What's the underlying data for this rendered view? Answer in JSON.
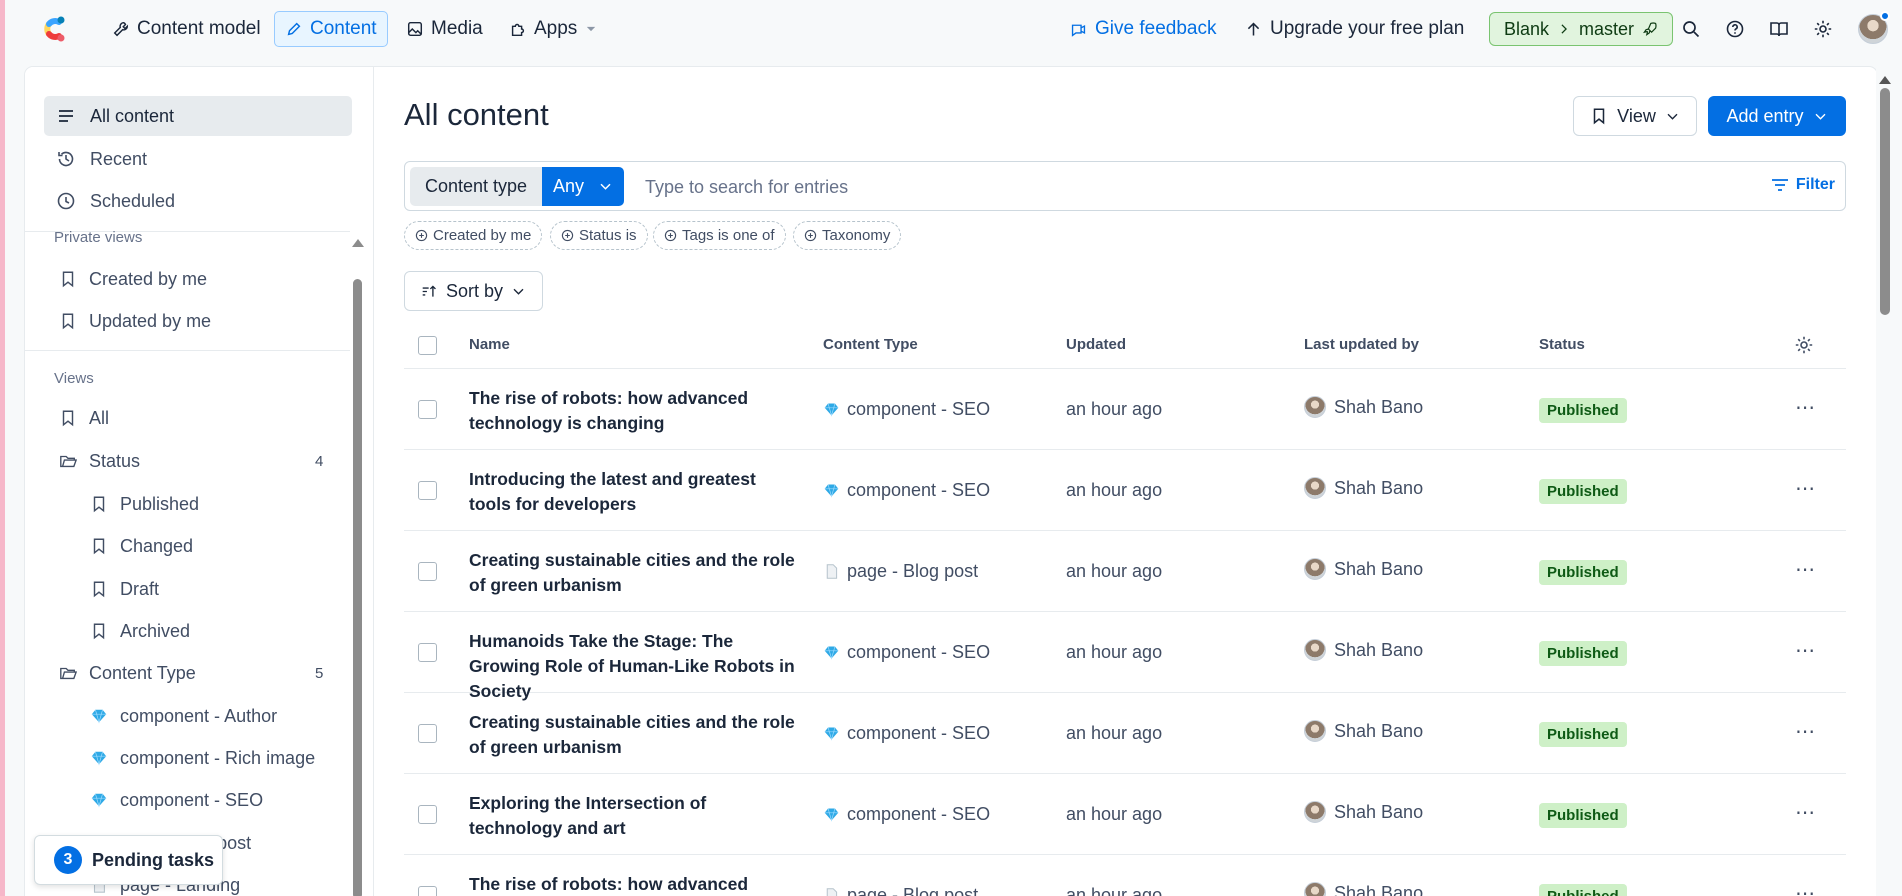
{
  "topnav": {
    "content_model": "Content model",
    "content": "Content",
    "media": "Media",
    "apps": "Apps",
    "give_feedback": "Give feedback",
    "upgrade": "Upgrade your free plan",
    "space": "Blank",
    "environment": "master"
  },
  "sidebar": {
    "top_items": [
      {
        "label": "All content",
        "icon": "list-icon",
        "active": true
      },
      {
        "label": "Recent",
        "icon": "history-icon"
      },
      {
        "label": "Scheduled",
        "icon": "clock-icon"
      }
    ],
    "private_views_heading": "Private views",
    "private_views": [
      "Created by me",
      "Updated by me"
    ],
    "views_heading": "Views",
    "views_all": "All",
    "status_folder": {
      "label": "Status",
      "count": "4",
      "items": [
        "Published",
        "Changed",
        "Draft",
        "Archived"
      ]
    },
    "content_type_folder": {
      "label": "Content Type",
      "count": "5",
      "items": [
        "component - Author",
        "component - Rich image",
        "component - SEO",
        "page - Blog post",
        "page - Landing"
      ]
    },
    "pending": {
      "count": "3",
      "label": "Pending tasks"
    }
  },
  "main": {
    "title": "All content",
    "view_button": "View",
    "add_button": "Add entry",
    "search": {
      "content_type_label": "Content type",
      "content_type_value": "Any",
      "placeholder": "Type to search for entries",
      "filter": "Filter"
    },
    "chips": [
      "Created by me",
      "Status is",
      "Tags is one of",
      "Taxonomy"
    ],
    "sort_label": "Sort by",
    "columns": {
      "name": "Name",
      "content_type": "Content Type",
      "updated": "Updated",
      "last_updated_by": "Last updated by",
      "status": "Status"
    },
    "rows": [
      {
        "name": "The rise of robots: how advanced technology is changing",
        "type": "component - SEO",
        "type_icon": "gem-icon",
        "updated": "an hour ago",
        "user": "Shah Bano",
        "status": "Published"
      },
      {
        "name": "Introducing the latest and greatest tools for developers",
        "type": "component - SEO",
        "type_icon": "gem-icon",
        "updated": "an hour ago",
        "user": "Shah Bano",
        "status": "Published"
      },
      {
        "name": "Creating sustainable cities and the role of green urbanism",
        "type": "page - Blog post",
        "type_icon": "page-icon",
        "updated": "an hour ago",
        "user": "Shah Bano",
        "status": "Published"
      },
      {
        "name": "Humanoids Take the Stage: The Growing Role of Human-Like Robots in Society",
        "type": "component - SEO",
        "type_icon": "gem-icon",
        "updated": "an hour ago",
        "user": "Shah Bano",
        "status": "Published"
      },
      {
        "name": "Creating sustainable cities and the role of green urbanism",
        "type": "component - SEO",
        "type_icon": "gem-icon",
        "updated": "an hour ago",
        "user": "Shah Bano",
        "status": "Published"
      },
      {
        "name": "Exploring the Intersection of technology and art",
        "type": "component - SEO",
        "type_icon": "gem-icon",
        "updated": "an hour ago",
        "user": "Shah Bano",
        "status": "Published"
      },
      {
        "name": "The rise of robots: how advanced",
        "type": "page - Blog post",
        "type_icon": "page-icon",
        "updated": "an hour ago",
        "user": "Shah Bano",
        "status": "Published"
      }
    ]
  },
  "colors": {
    "accent": "#036fe3",
    "published_bg": "#cef0c7",
    "env_bg": "#e1f4de"
  }
}
